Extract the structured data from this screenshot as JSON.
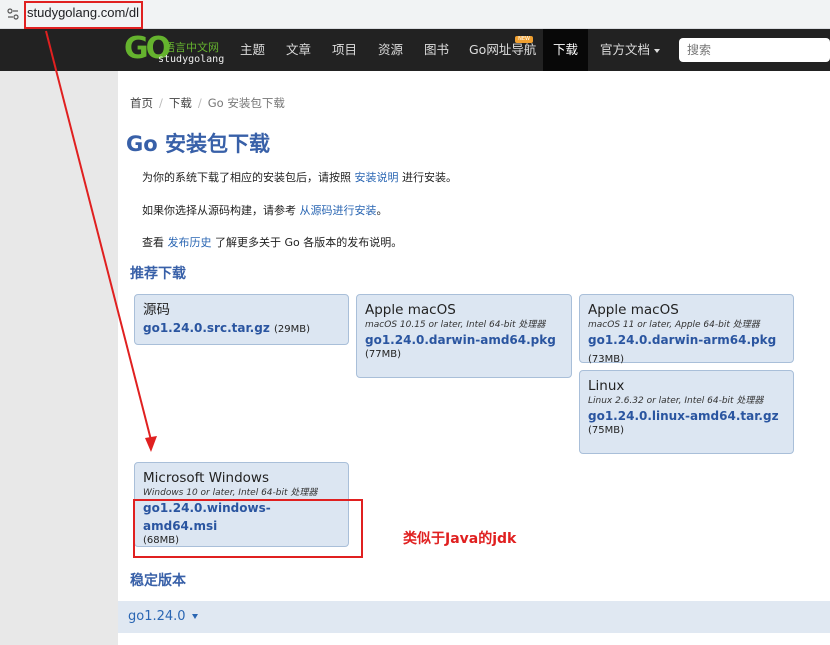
{
  "browser": {
    "url": "studygolang.com/dl"
  },
  "navbar": {
    "logo_cn": "语言中文网",
    "logo_en": "studygolang",
    "items": [
      "主题",
      "文章",
      "项目",
      "资源",
      "图书",
      "Go网址导航",
      "下载",
      "官方文档"
    ],
    "new_badge": "NEW",
    "search_placeholder": "搜索"
  },
  "breadcrumb": {
    "home": "首页",
    "download": "下载",
    "current": "Go 安装包下载"
  },
  "page": {
    "title": "Go 安装包下载",
    "p1_before": "为你的系统下载了相应的安装包后，请按照 ",
    "p1_link": "安装说明",
    "p1_after": " 进行安装。",
    "p2_before": "如果你选择从源码构建，请参考 ",
    "p2_link": "从源码进行安装",
    "p2_after": "。",
    "p3_before": "查看 ",
    "p3_link": "发布历史",
    "p3_after": " 了解更多关于 Go 各版本的发布说明。",
    "recommended_title": "推荐下载",
    "stable_title": "稳定版本",
    "stable_version": "go1.24.0"
  },
  "downloads": {
    "source": {
      "title": "源码",
      "file": "go1.24.0.src.tar.gz",
      "size": "(29MB)"
    },
    "mac_intel": {
      "title": "Apple macOS",
      "sub": "macOS 10.15 or later, Intel 64-bit 处理器",
      "file": "go1.24.0.darwin-amd64.pkg",
      "size": "(77MB)"
    },
    "mac_arm": {
      "title": "Apple macOS",
      "sub": "macOS 11 or later, Apple 64-bit 处理器",
      "file": "go1.24.0.darwin-arm64.pkg",
      "size": "(73MB)"
    },
    "linux": {
      "title": "Linux",
      "sub": "Linux 2.6.32 or later, Intel 64-bit 处理器",
      "file": "go1.24.0.linux-amd64.tar.gz",
      "size": "(75MB)"
    },
    "windows": {
      "title": "Microsoft Windows",
      "sub": "Windows 10 or later, Intel 64-bit 处理器",
      "file": "go1.24.0.windows-amd64.msi",
      "size": "(68MB)"
    }
  },
  "annotation": {
    "note": "类似于Java的jdk"
  },
  "colors": {
    "accent": "#3860a8",
    "link": "#2a66b3",
    "annotation": "#e02020",
    "navbar": "#222222"
  }
}
